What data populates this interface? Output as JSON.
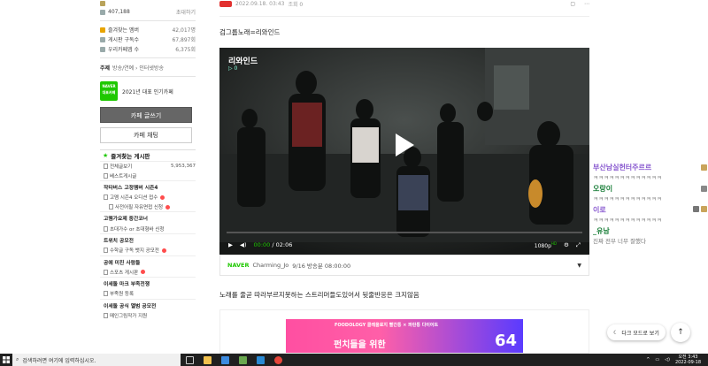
{
  "sidebar": {
    "member_count": "407,188",
    "invite_label": "초대하기",
    "stats": [
      {
        "label": "즐겨찾는 멤버",
        "value": "42,017명"
      },
      {
        "label": "게시판 구독수",
        "value": "67,897회"
      },
      {
        "label": "우리카페앱 수",
        "value": "6,375회"
      }
    ],
    "topic_label": "주제",
    "topic_value": "방송/연예 › 인터넷방송",
    "award_badge_line1": "NAVER",
    "award_badge_line2": "대표카페",
    "award_text": "2021년 대표 인기카페",
    "write_button": "카페 글쓰기",
    "chat_button": "카페 채팅",
    "favorites_title": "즐겨찾는 게시판",
    "board_items": [
      {
        "label": "전체글보기",
        "count": "5,953,367"
      },
      {
        "label": "베스트게시글",
        "count": ""
      }
    ],
    "groups": [
      {
        "title": "작타버스 고정멤버 시즌4",
        "items": [
          {
            "label": "고멤 시즌4 오디션 접수",
            "new": true
          },
          {
            "label": "사전어필 자유면접 신청",
            "new": true,
            "sub": true
          }
        ]
      },
      {
        "title": "고멤가요제 중간코너",
        "items": [
          {
            "label": "초대가수 or 초대형바 신청",
            "new": false
          }
        ]
      },
      {
        "title": "트위치 공모전",
        "items": [
          {
            "label": "수학글 구독 뱃지 공모전",
            "new": true
          }
        ]
      },
      {
        "title": "공에 미친 사람들",
        "items": [
          {
            "label": "스포츠 게시판",
            "new": true
          }
        ]
      },
      {
        "title": "이세돌 마크 부족전쟁",
        "items": [
          {
            "label": "부족원 등록",
            "new": false
          }
        ]
      },
      {
        "title": "이세돌 공식 앨범 공모전",
        "items": [
          {
            "label": "메인그림작가 지원",
            "new": false
          }
        ]
      }
    ]
  },
  "post": {
    "date": "2022.09.18. 03:43",
    "views": "조회 0",
    "title": "검그룹노래=리와인드",
    "body": "노래를 줄곧 따라부르지못하는 스트리머들도있어서 뒷줄반응은 크지않음"
  },
  "video": {
    "channel": "리와인드",
    "viewer_count": "0",
    "time_current": "00:00",
    "time_total": "02:06",
    "progress": 0,
    "quality": "1080p",
    "platform": "NAVER",
    "author": "Charming_Jo",
    "caption": "9/16 방송분 08:00:00"
  },
  "ad": {
    "brand": "FOODOLOGY 콜레올로지",
    "brand_tag": "빨간통 × 파란통 다이어트",
    "headline": "펀치들을 위한",
    "number": "64"
  },
  "chat": [
    {
      "nick": "부산남실헌터주르르",
      "color": "#8a5bd0",
      "msg": "ㅋㅋㅋㅋㅋㅋㅋㅋㅋㅋㅋㅋㅋ"
    },
    {
      "nick": "오랑이",
      "color": "#1b7f3a",
      "msg": "ㅋㅋㅋㅋㅋㅋㅋㅋㅋㅋㅋㅋㅋ"
    },
    {
      "nick": "이로",
      "color": "#8a5bd0",
      "msg": "ㅋㅋㅋㅋㅋㅋㅋㅋㅋㅋㅋㅋㅋ"
    },
    {
      "nick": "_유남",
      "color": "#1b7f3a",
      "msg": "진짜 전부 너무 잘했다"
    }
  ],
  "floating": {
    "dark_mode": "다크 모드로 보기"
  },
  "taskbar": {
    "search_placeholder": "검색하려면 여기에 입력하십시오.",
    "time": "오전 3:43",
    "date": "2022-09-18"
  }
}
